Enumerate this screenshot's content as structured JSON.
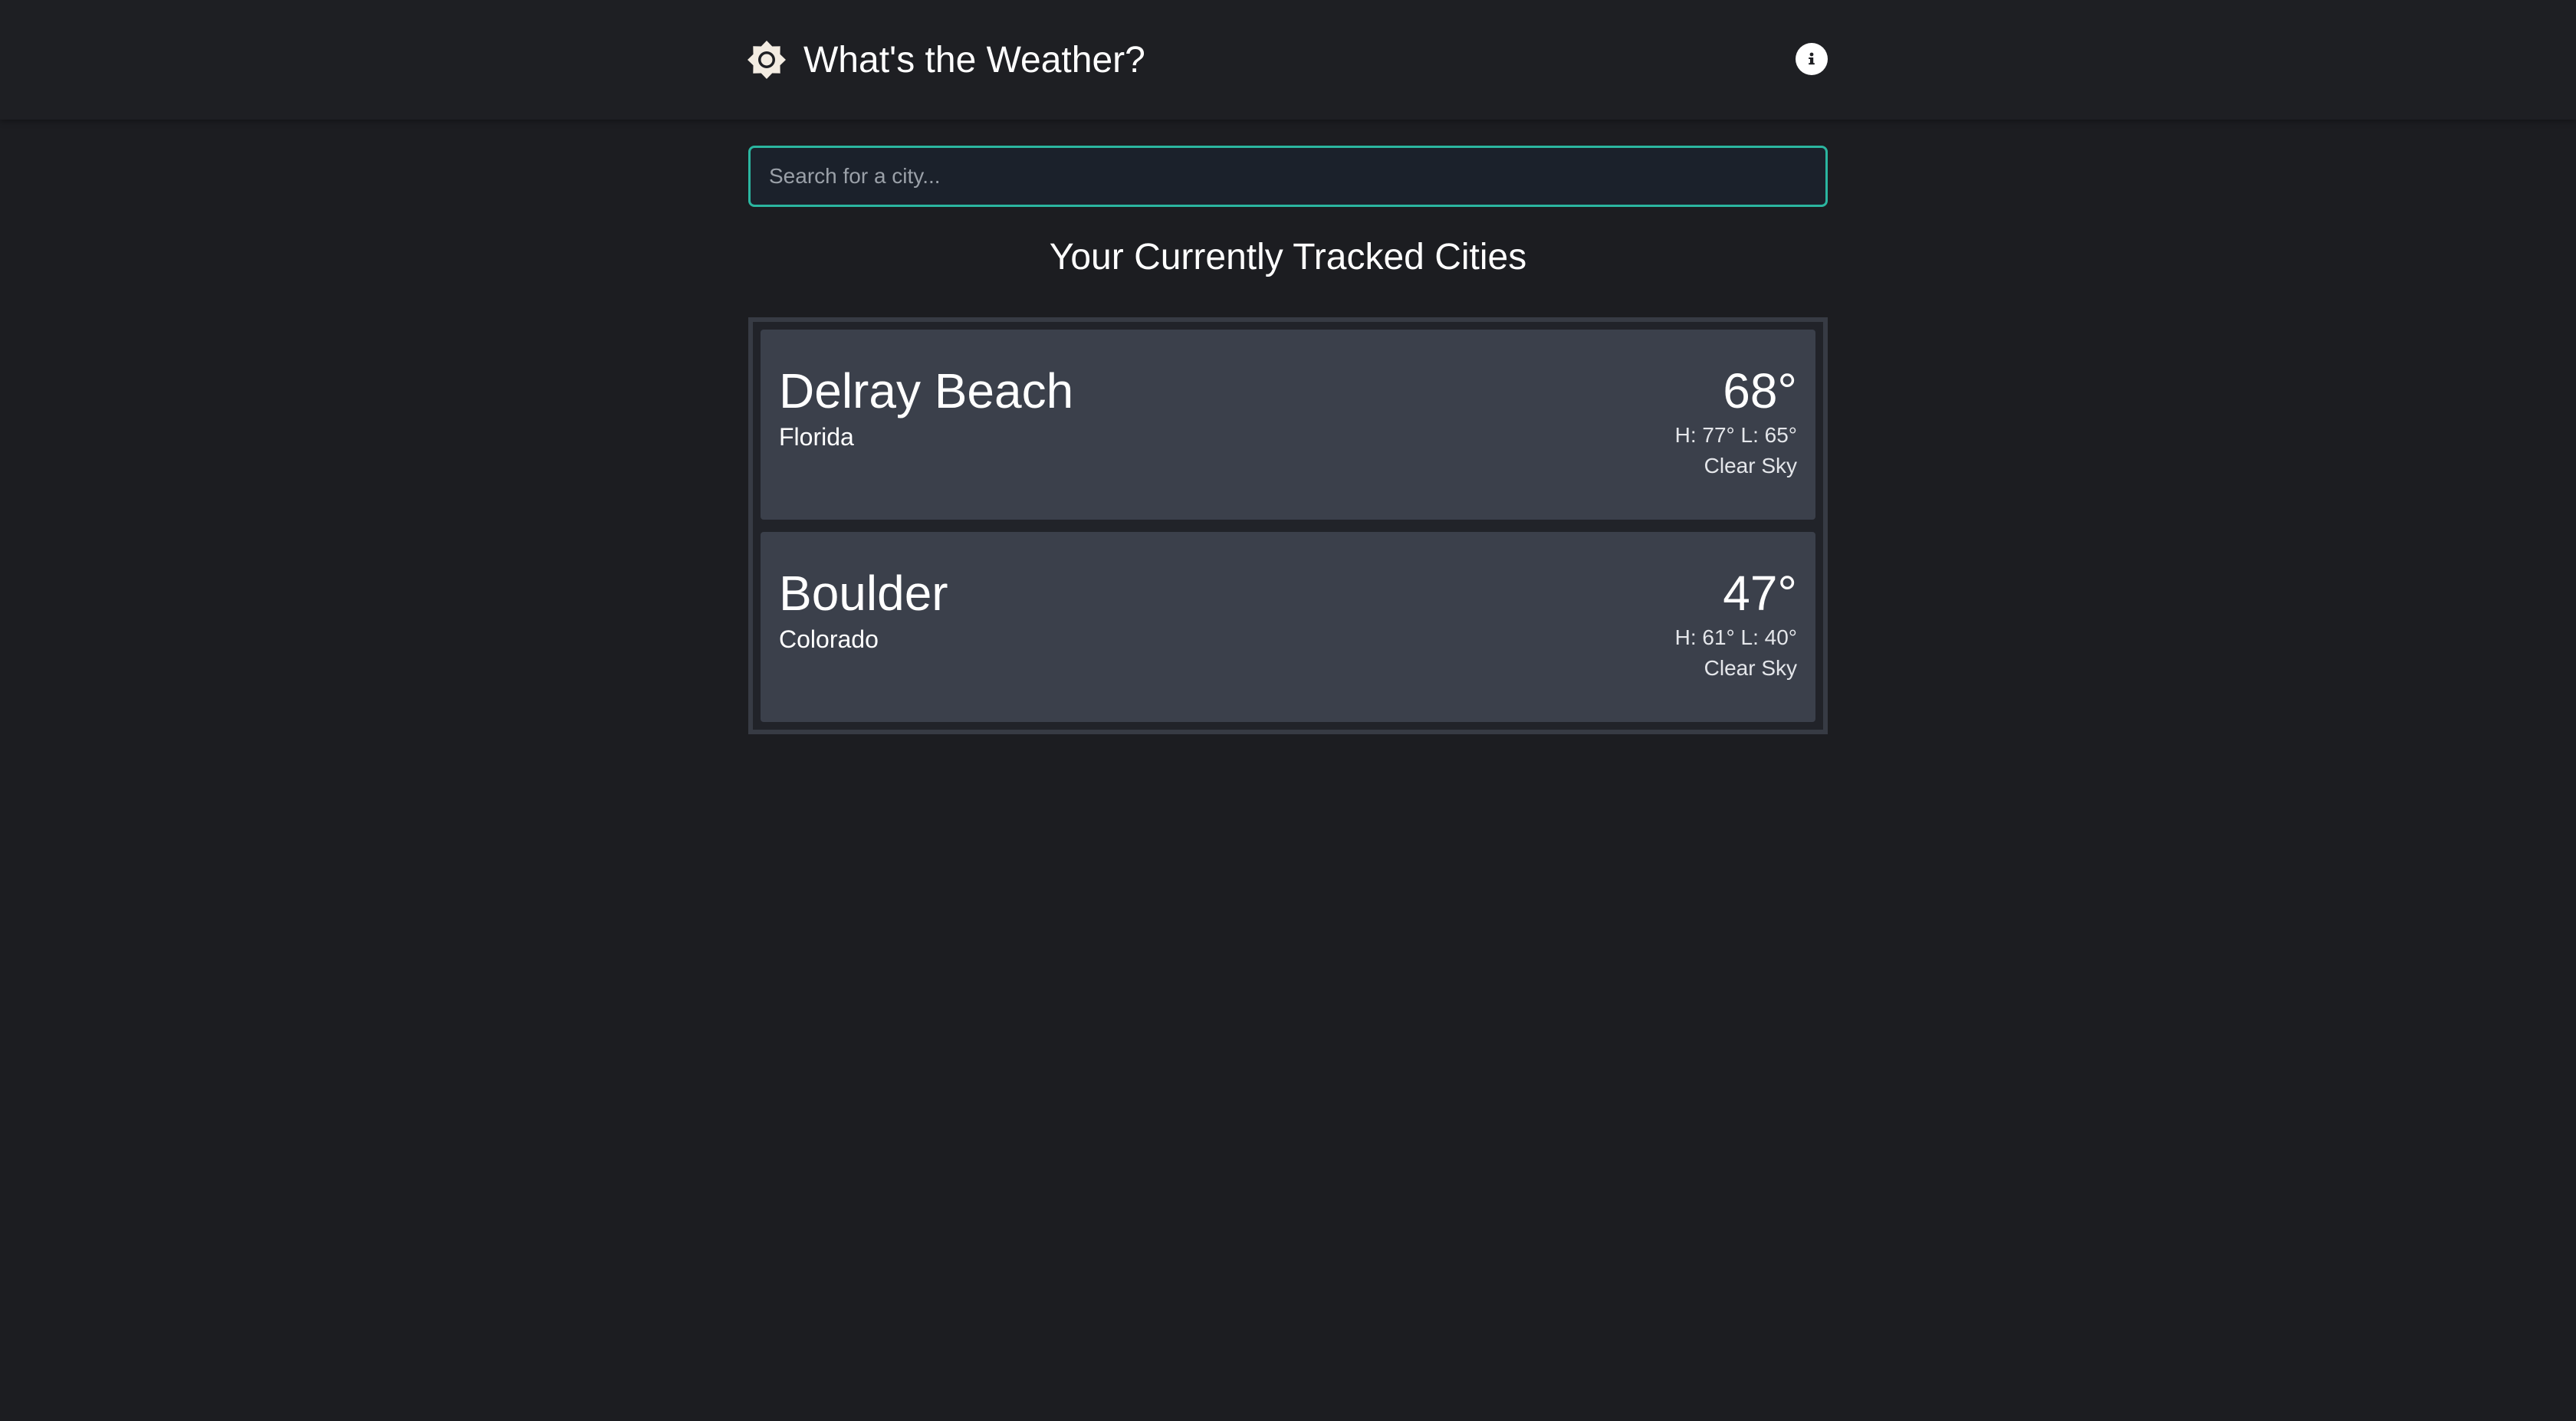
{
  "header": {
    "title": "What's the Weather?",
    "logo_icon": "sun-icon",
    "info_icon": "info-icon"
  },
  "search": {
    "placeholder": "Search for a city...",
    "value": ""
  },
  "tracked": {
    "title": "Your Currently Tracked Cities",
    "cities": [
      {
        "name": "Delray Beach",
        "state": "Florida",
        "temp": "68°",
        "hilo": "H: 77° L: 65°",
        "condition": "Clear Sky"
      },
      {
        "name": "Boulder",
        "state": "Colorado",
        "temp": "47°",
        "hilo": "H: 61° L: 40°",
        "condition": "Clear Sky"
      }
    ]
  },
  "colors": {
    "background": "#1c1d21",
    "header": "#1e1f23",
    "accent": "#2bb6a0",
    "card": "#3b404b",
    "list_border": "#373b44"
  }
}
